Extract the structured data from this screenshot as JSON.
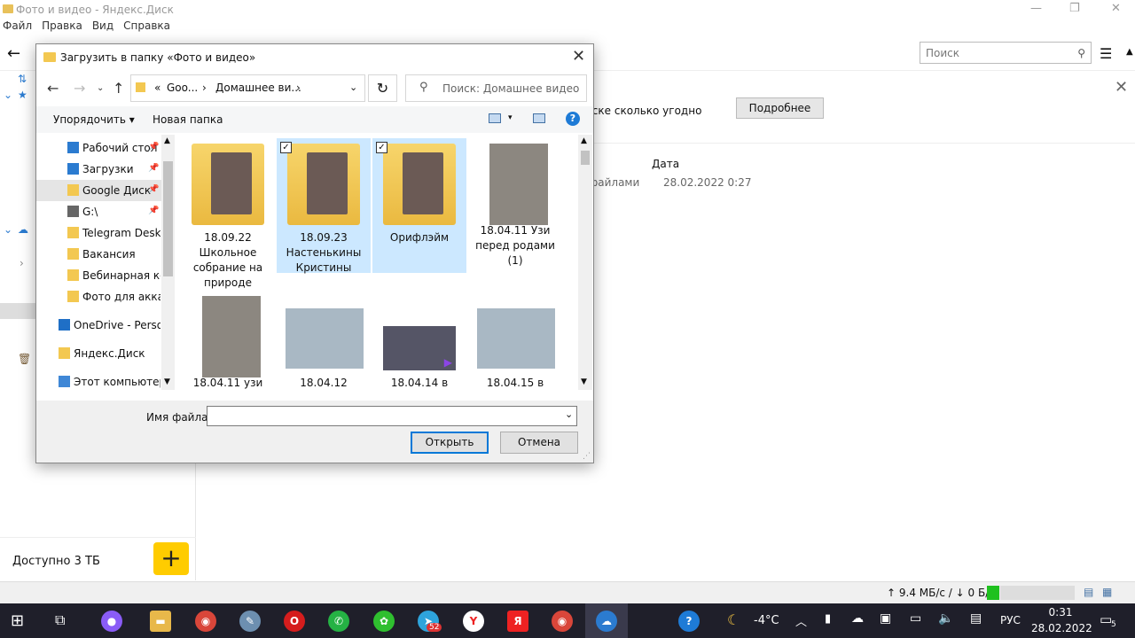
{
  "app": {
    "title": "Фото и видео - Яндекс.Диск",
    "menu": [
      "Файл",
      "Правка",
      "Вид",
      "Справка"
    ],
    "search_placeholder": "Поиск",
    "promo_text": "иске сколько угодно",
    "promo_button": "Подробнее",
    "column_date": "Дата",
    "row_name": "файлами",
    "row_date": "28.02.2022 0:27",
    "available": "Доступно 3 ТБ",
    "status_speed": "↑ 9.4 МБ/с / ↓ 0 Б/с"
  },
  "dialog": {
    "title": "Загрузить в папку «Фото и видео»",
    "address": {
      "root_sep": "«",
      "seg1": "Goo...",
      "seg2": "Домашнее ви..."
    },
    "search_placeholder": "Поиск: Домашнее видео",
    "organize": "Упорядочить",
    "new_folder": "Новая папка",
    "nav_items": [
      {
        "label": "Рабочий стол",
        "pinned": true,
        "color": "#2b7bd0"
      },
      {
        "label": "Загрузки",
        "pinned": true,
        "color": "#2b7bd0"
      },
      {
        "label": "Google Диск",
        "pinned": true,
        "color": "#f3c851"
      },
      {
        "label": "G:\\",
        "pinned": true,
        "color": "#666666"
      },
      {
        "label": "Telegram Desktop",
        "pinned": false,
        "color": "#f3c851"
      },
      {
        "label": "Вакансия",
        "pinned": false,
        "color": "#f3c851"
      },
      {
        "label": "Вебинарная комната",
        "pinned": false,
        "color": "#f3c851"
      },
      {
        "label": "Фото для аккаунта",
        "pinned": false,
        "color": "#f3c851"
      },
      {
        "label": "OneDrive - Personal",
        "pinned": false,
        "color": "#1f6fc6"
      },
      {
        "label": "Яндекс.Диск",
        "pinned": false,
        "color": "#f3c851"
      },
      {
        "label": "Этот компьютер",
        "pinned": false,
        "color": "#3f87d6"
      }
    ],
    "files": [
      {
        "label": "18.09.22 Школьное собрание на природе",
        "kind": "folder",
        "selected": false
      },
      {
        "label": "18.09.23 Настенькины Кристины",
        "kind": "folder",
        "selected": true
      },
      {
        "label": "Орифлэйм",
        "kind": "folder",
        "selected": true
      },
      {
        "label": "18.04.11 Узи перед родами (1)",
        "kind": "doc",
        "selected": false
      },
      {
        "label": "18.04.11 узи",
        "kind": "doc",
        "selected": false
      },
      {
        "label": "18.04.12",
        "kind": "photo",
        "selected": false
      },
      {
        "label": "18.04.14 в",
        "kind": "video",
        "selected": false
      },
      {
        "label": "18.04.15 в",
        "kind": "photo",
        "selected": false
      }
    ],
    "filename_label": "Имя файла:",
    "filename_value": "",
    "open_button": "Открыть",
    "cancel_button": "Отмена"
  },
  "taskbar": {
    "temperature": "-4°C",
    "language": "РУС",
    "time": "0:31",
    "date": "28.02.2022",
    "telegram_badge": "52",
    "notifications": "5"
  }
}
